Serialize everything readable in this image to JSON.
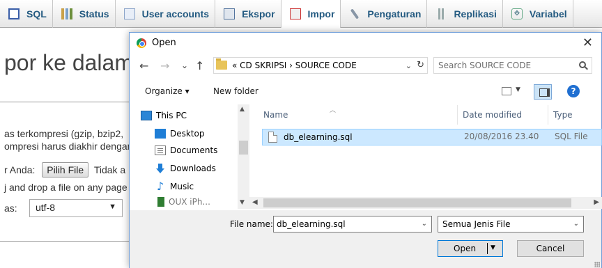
{
  "pma": {
    "tabs": [
      {
        "label": "SQL",
        "icon": "sql-icon"
      },
      {
        "label": "Status",
        "icon": "status-icon"
      },
      {
        "label": "User accounts",
        "icon": "user-accounts-icon"
      },
      {
        "label": "Ekspor",
        "icon": "export-icon"
      },
      {
        "label": "Impor",
        "icon": "import-icon"
      },
      {
        "label": "Pengaturan",
        "icon": "settings-icon"
      },
      {
        "label": "Replikasi",
        "icon": "replication-icon"
      },
      {
        "label": "Variabel",
        "icon": "variables-icon"
      }
    ],
    "heading": "por ke dalam s",
    "compressed_line1": "as terkompresi (gzip, bzip2,",
    "compressed_line2": "ompresi harus diakhir dengan",
    "file_label": "r Anda:",
    "choose_file_button": "Pilih File",
    "no_file_text": "Tidak a",
    "drag_drop_text": "j and drop a file on any page",
    "charset_label": "as:",
    "charset_value": "utf-8"
  },
  "dialog": {
    "title": "Open",
    "close_glyph": "✕",
    "nav": {
      "back": "←",
      "forward": "→",
      "recent": "⌄",
      "up": "↑"
    },
    "address_path": "« CD SKRIPSI › SOURCE CODE",
    "address_dropdown": "⌄",
    "refresh_glyph": "↻",
    "search_placeholder": "Search SOURCE CODE",
    "toolbar": {
      "organize": "Organize ▾",
      "new_folder": "New folder",
      "help": "?"
    },
    "tree": [
      {
        "label": "This PC",
        "icon": "pc-icon"
      },
      {
        "label": "Desktop",
        "icon": "desktop-icon"
      },
      {
        "label": "Documents",
        "icon": "documents-icon"
      },
      {
        "label": "Downloads",
        "icon": "downloads-icon"
      },
      {
        "label": "Music",
        "icon": "music-icon"
      },
      {
        "label": "OUX iPh...",
        "icon": "folder-icon"
      }
    ],
    "columns": {
      "name": "Name",
      "date_modified": "Date modified",
      "type": "Type"
    },
    "files": [
      {
        "name": "db_elearning.sql",
        "date_modified": "20/08/2016 23.40",
        "type": "SQL File"
      }
    ],
    "file_name_label": "File name:",
    "file_name_value": "db_elearning.sql",
    "file_type_value": "Semua Jenis File",
    "open_button": "Open",
    "cancel_button": "Cancel"
  },
  "colors": {
    "pma_link": "#235a81",
    "selection_bg": "#cce8ff",
    "dialog_footer": "#f0f0f0",
    "accent_blue": "#0078d7"
  }
}
